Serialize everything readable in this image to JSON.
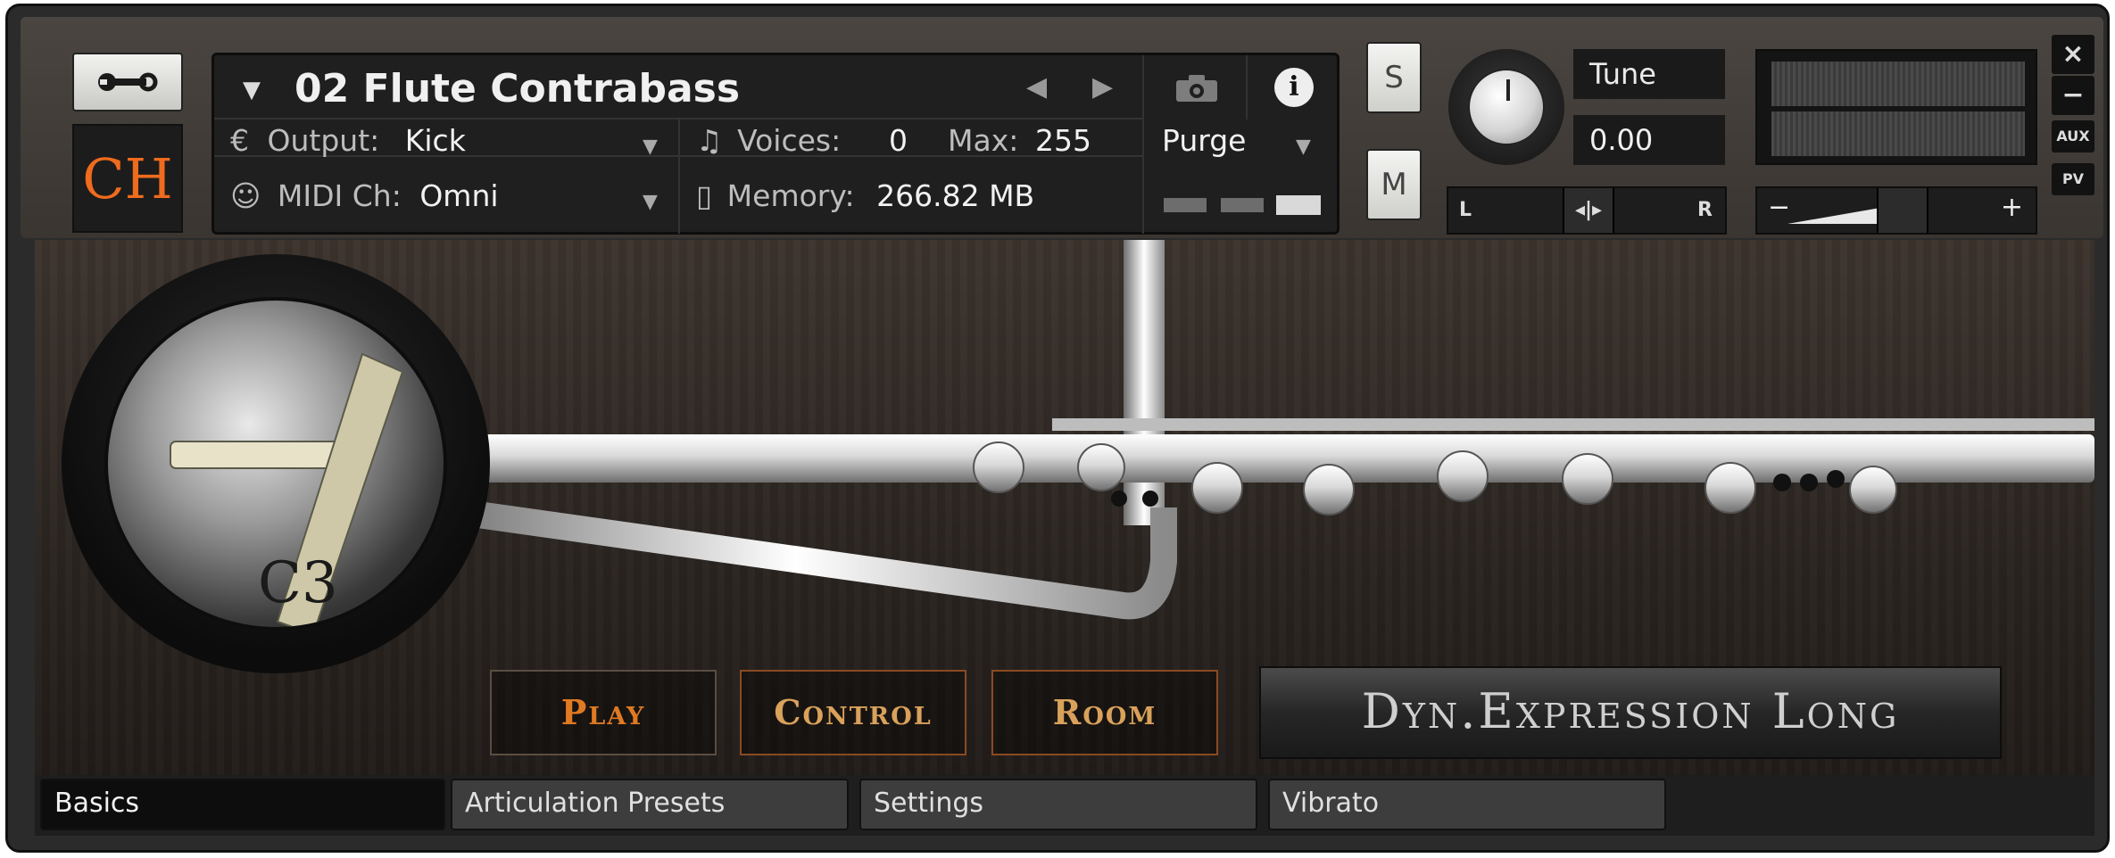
{
  "instrument": {
    "name": "02 Flute Contrabass",
    "logo_text": "CH",
    "output_label": "Output:",
    "output_value": "Kick",
    "midi_label": "MIDI Ch:",
    "midi_value": "Omni",
    "voices_label": "Voices:",
    "voices_value": "0",
    "max_label": "Max:",
    "max_value": "255",
    "memory_label": "Memory:",
    "memory_value": "266.82 MB",
    "purge_label": "Purge"
  },
  "controls": {
    "solo_label": "S",
    "mute_label": "M",
    "tune_label": "Tune",
    "tune_value": "0.00",
    "pan_left": "L",
    "pan_right": "R",
    "vol_minus": "−",
    "vol_plus": "+",
    "close_label": "×",
    "min_label": "−",
    "aux_label": "AUX",
    "pv_label": "PV"
  },
  "main": {
    "note": "C3",
    "buttons": [
      {
        "label": "Play",
        "color": "#e07a22"
      },
      {
        "label": "Control",
        "color": "#d9a15a"
      },
      {
        "label": "Room",
        "color": "#d9a15a"
      }
    ],
    "articulation": "Dyn.Expression Long"
  },
  "tabs": [
    {
      "label": "Basics",
      "active": true
    },
    {
      "label": "Articulation Presets",
      "active": false
    },
    {
      "label": "Settings",
      "active": false
    },
    {
      "label": "Vibrato",
      "active": false
    }
  ],
  "colors": {
    "accent_orange": "#ef6b1e",
    "play_orange": "#e07a22",
    "button_gold": "#d9a15a"
  }
}
